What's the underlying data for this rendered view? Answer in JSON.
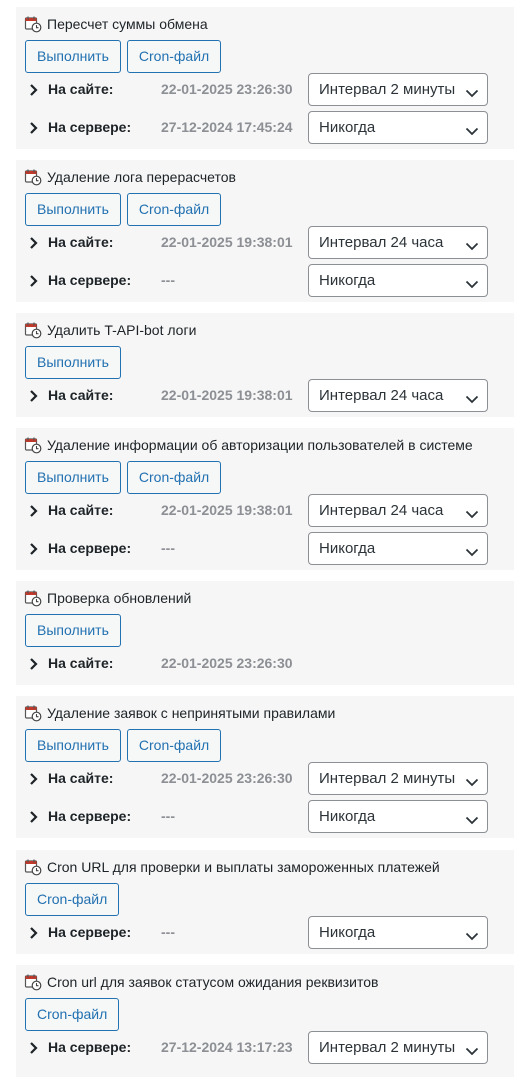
{
  "tasks": [
    {
      "title": "Пересчет суммы обмена",
      "buttons": [
        "Выполнить",
        "Cron-файл"
      ],
      "rows": [
        {
          "label": "На сайте:",
          "time": "22-01-2025 23:26:30",
          "select": "Интервал 2 минуты"
        },
        {
          "label": "На сервере:",
          "time": "27-12-2024 17:45:24",
          "select": "Никогда"
        }
      ]
    },
    {
      "title": "Удаление лога перерасчетов",
      "buttons": [
        "Выполнить",
        "Cron-файл"
      ],
      "rows": [
        {
          "label": "На сайте:",
          "time": "22-01-2025 19:38:01",
          "select": "Интервал 24 часа"
        },
        {
          "label": "На сервере:",
          "time": "---",
          "select": "Никогда"
        }
      ]
    },
    {
      "title": "Удалить T-API-bot логи",
      "buttons": [
        "Выполнить"
      ],
      "rows": [
        {
          "label": "На сайте:",
          "time": "22-01-2025 19:38:01",
          "select": "Интервал 24 часа"
        }
      ]
    },
    {
      "title": "Удаление информации об авторизации пользователей в системе",
      "buttons": [
        "Выполнить",
        "Cron-файл"
      ],
      "rows": [
        {
          "label": "На сайте:",
          "time": "22-01-2025 19:38:01",
          "select": "Интервал 24 часа"
        },
        {
          "label": "На сервере:",
          "time": "---",
          "select": "Никогда"
        }
      ]
    },
    {
      "title": "Проверка обновлений",
      "buttons": [
        "Выполнить"
      ],
      "rows": [
        {
          "label": "На сайте:",
          "time": "22-01-2025 23:26:30",
          "select": null
        }
      ]
    },
    {
      "title": "Удаление заявок с непринятыми правилами",
      "buttons": [
        "Выполнить",
        "Cron-файл"
      ],
      "rows": [
        {
          "label": "На сайте:",
          "time": "22-01-2025 23:26:30",
          "select": "Интервал 2 минуты"
        },
        {
          "label": "На сервере:",
          "time": "---",
          "select": "Никогда"
        }
      ]
    },
    {
      "title": "Cron URL для проверки и выплаты замороженных платежей",
      "buttons": [
        "Cron-файл"
      ],
      "rows": [
        {
          "label": "На сервере:",
          "time": "---",
          "select": "Никогда"
        }
      ]
    },
    {
      "title": "Cron url для заявок статусом ожидания реквизитов",
      "buttons": [
        "Cron-файл"
      ],
      "rows": [
        {
          "label": "На сервере:",
          "time": "27-12-2024 13:17:23",
          "select": "Интервал 2 минуты"
        }
      ]
    }
  ]
}
